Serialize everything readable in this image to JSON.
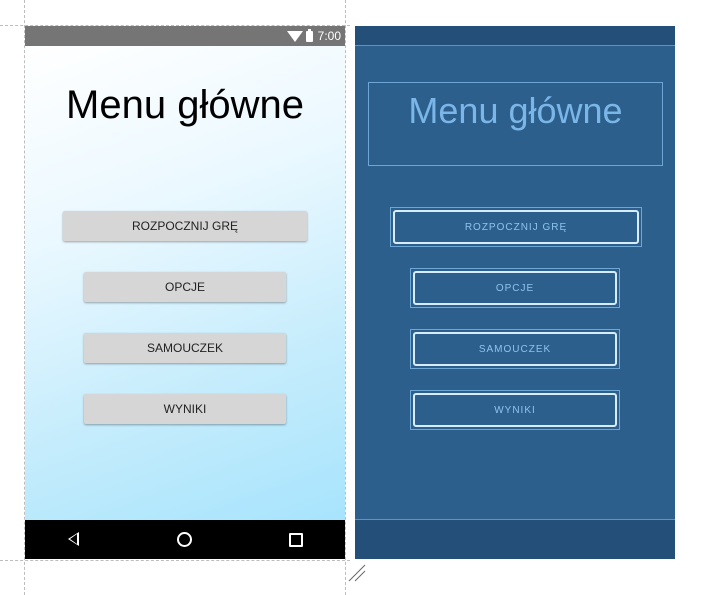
{
  "status_bar": {
    "time": "7:00",
    "wifi_icon": "wifi-icon",
    "battery_icon": "battery-icon"
  },
  "screen": {
    "title": "Menu główne",
    "buttons": {
      "start": "ROZPOCZNIJ GRĘ",
      "options": "OPCJE",
      "tutorial": "SAMOUCZEK",
      "results": "WYNIKI"
    }
  },
  "nav_bar": {
    "back_icon": "back-triangle-icon",
    "home_icon": "home-circle-icon",
    "recents_icon": "recents-square-icon"
  },
  "colors": {
    "background_gradient_start": "#ffffff",
    "background_gradient_end": "#a7e4fd",
    "button": "#d6d6d6",
    "status_bar": "#757575",
    "nav_bar": "#000000",
    "blueprint_bg": "#2d5f8c",
    "blueprint_line": "#6ea6d6"
  }
}
